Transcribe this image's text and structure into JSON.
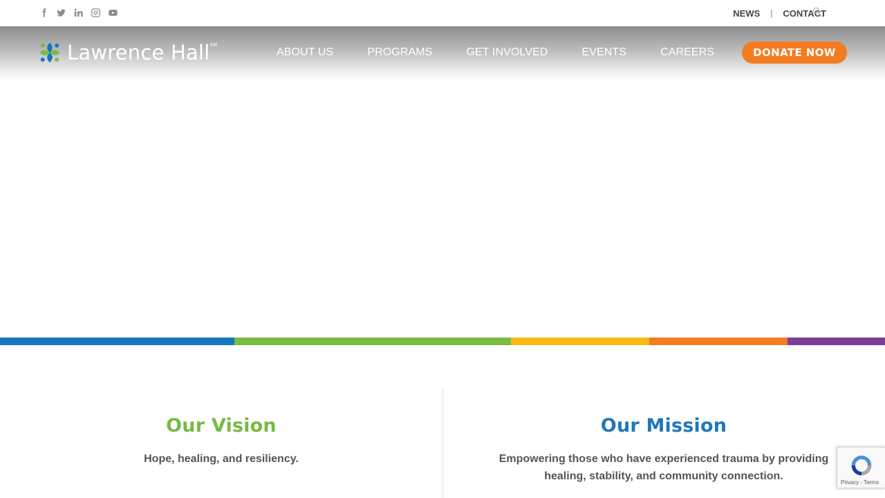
{
  "topbar": {
    "social_icons": [
      "facebook-icon",
      "twitter-icon",
      "linkedin-icon",
      "instagram-icon",
      "youtube-icon"
    ],
    "news_label": "NEWS",
    "separator": "|",
    "contact_label": "CONTACT",
    "search_icon": "search-icon"
  },
  "header": {
    "logo_text": "Lawrence Hall",
    "logo_mark": "SM",
    "nav": {
      "about": "ABOUT US",
      "programs": "PROGRAMS",
      "get_involved": "GET INVOLVED",
      "events": "EVENTS",
      "careers": "CAREERS"
    },
    "donate_label": "DONATE NOW"
  },
  "stripe_colors": [
    "#1577be",
    "#79bb43",
    "#fdb913",
    "#f37c20",
    "#7b3f98"
  ],
  "vision": {
    "title": "Our Vision",
    "text": "Hope, healing, and resiliency."
  },
  "mission": {
    "title": "Our Mission",
    "text": "Empowering those who have experienced trauma by providing healing, stability, and community connection."
  },
  "recaptcha": {
    "links": "Privacy - Terms"
  },
  "colors": {
    "vision_green": "#78b943",
    "mission_blue": "#1f77bb",
    "donate_orange": "#f37c20"
  }
}
